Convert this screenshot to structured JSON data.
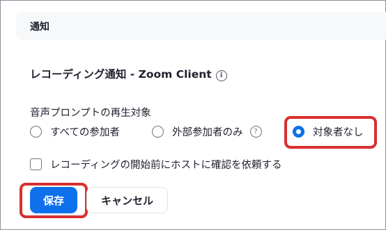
{
  "section": {
    "title": "通知"
  },
  "setting": {
    "title": "レコーディング通知 - Zoom Client",
    "info_icon": "info-icon"
  },
  "prompt": {
    "label": "音声プロンプトの再生対象",
    "options": [
      {
        "label": "すべての参加者",
        "selected": false
      },
      {
        "label": "外部参加者のみ",
        "selected": false,
        "help_icon": "question-circle-icon"
      },
      {
        "label": "対象者なし",
        "selected": true
      }
    ]
  },
  "confirm": {
    "label": "レコーディングの開始前にホストに確認を依頼する",
    "checked": false
  },
  "buttons": {
    "save": "保存",
    "cancel": "キャンセル"
  },
  "colors": {
    "accent": "#0e71eb",
    "highlight": "#d8302f"
  }
}
